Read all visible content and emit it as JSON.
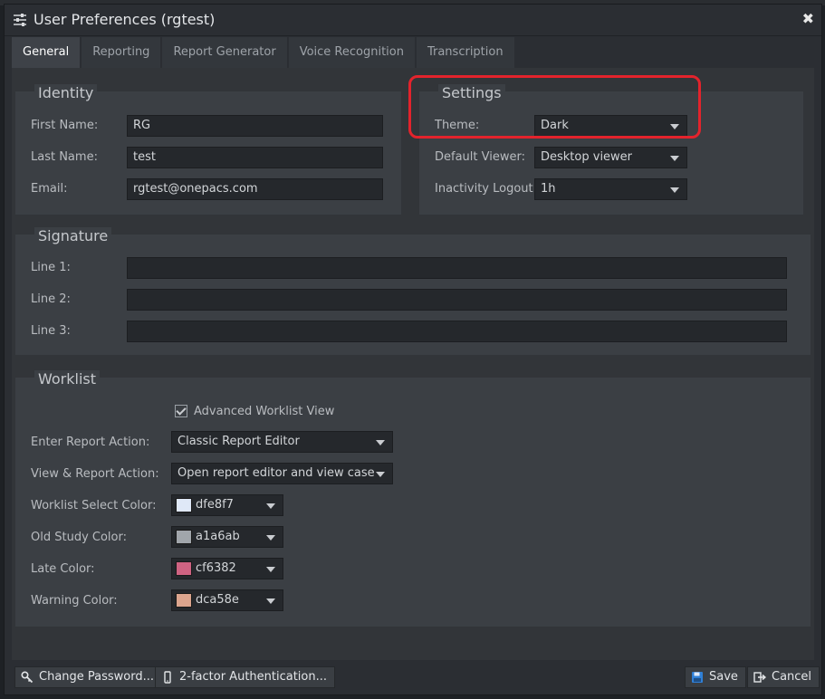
{
  "window": {
    "title": "User Preferences (rgtest)",
    "close_glyph": "✖"
  },
  "tabs": [
    {
      "label": "General",
      "active": true
    },
    {
      "label": "Reporting"
    },
    {
      "label": "Report Generator"
    },
    {
      "label": "Voice Recognition"
    },
    {
      "label": "Transcription"
    }
  ],
  "identity": {
    "title": "Identity",
    "first_name_label": "First Name:",
    "first_name": "RG",
    "last_name_label": "Last Name:",
    "last_name": "test",
    "email_label": "Email:",
    "email": "rgtest@onepacs.com"
  },
  "settings": {
    "title": "Settings",
    "theme_label": "Theme:",
    "theme": "Dark",
    "viewer_label": "Default Viewer:",
    "viewer": "Desktop viewer",
    "logout_label": "Inactivity Logout:",
    "logout": "1h"
  },
  "signature": {
    "title": "Signature",
    "line1_label": "Line 1:",
    "line1": "",
    "line2_label": "Line 2:",
    "line2": "",
    "line3_label": "Line 3:",
    "line3": ""
  },
  "worklist": {
    "title": "Worklist",
    "advanced_label": "Advanced Worklist View",
    "advanced_checked": true,
    "enter_action_label": "Enter Report Action:",
    "enter_action": "Classic Report Editor",
    "view_action_label": "View & Report Action:",
    "view_action": "Open report editor and view case",
    "select_color_label": "Worklist Select Color:",
    "select_color": "dfe8f7",
    "old_color_label": "Old Study Color:",
    "old_color": "a1a6ab",
    "late_color_label": "Late Color:",
    "late_color": "cf6382",
    "warning_color_label": "Warning Color:",
    "warning_color": "dca58e"
  },
  "footer": {
    "change_password": "Change Password...",
    "two_factor": "2-factor Authentication...",
    "save": "Save",
    "cancel": "Cancel"
  },
  "colors": {
    "highlight": "#e3232c",
    "select_swatch": "#dfe8f7",
    "old_swatch": "#a1a6ab",
    "late_swatch": "#cf6382",
    "warning_swatch": "#dca58e"
  }
}
